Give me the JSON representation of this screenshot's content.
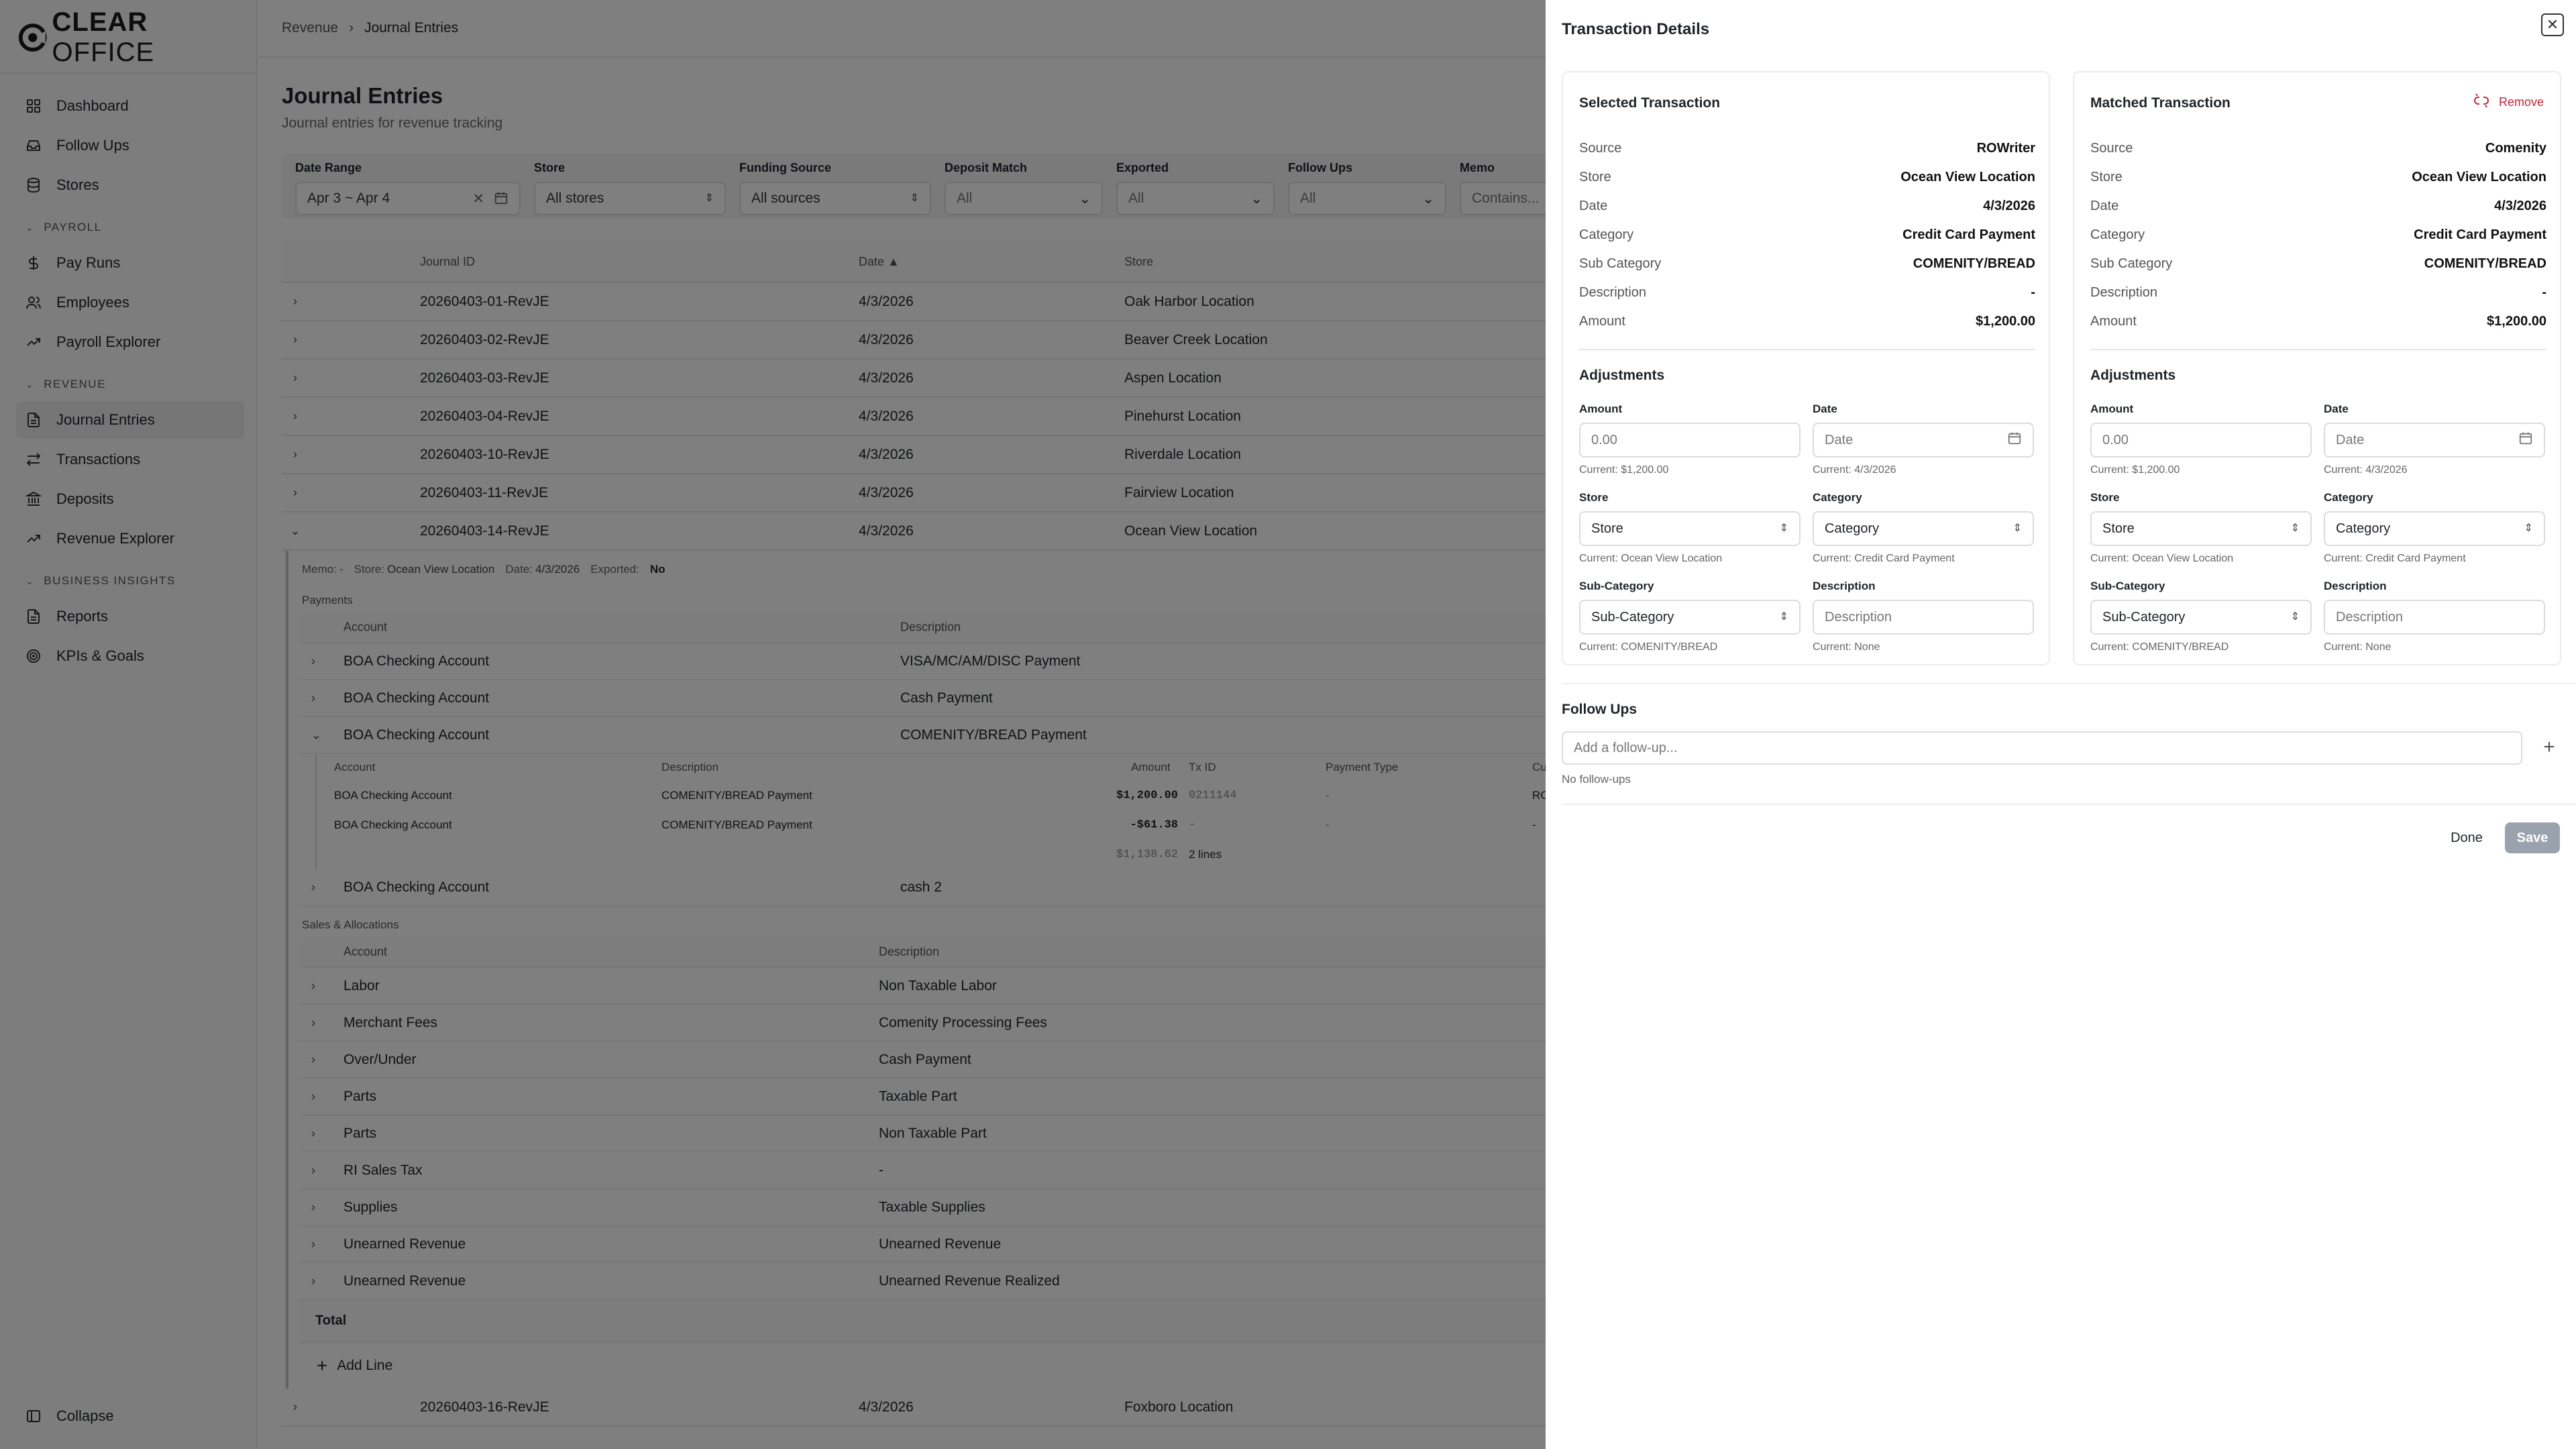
{
  "app": {
    "logo_text_bold": "CLEAR",
    "logo_text_light": " OFFICE"
  },
  "sidebar": {
    "items_top": [
      {
        "label": "Dashboard",
        "icon": "grid-icon"
      },
      {
        "label": "Follow Ups",
        "icon": "inbox-icon"
      },
      {
        "label": "Stores",
        "icon": "database-icon"
      }
    ],
    "groups": [
      {
        "label": "PAYROLL",
        "items": [
          {
            "label": "Pay Runs",
            "icon": "dollar-icon"
          },
          {
            "label": "Employees",
            "icon": "users-icon"
          },
          {
            "label": "Payroll Explorer",
            "icon": "trend-icon"
          }
        ]
      },
      {
        "label": "REVENUE",
        "items": [
          {
            "label": "Journal Entries",
            "icon": "file-icon",
            "active": true
          },
          {
            "label": "Transactions",
            "icon": "arrows-icon"
          },
          {
            "label": "Deposits",
            "icon": "bank-icon"
          },
          {
            "label": "Revenue Explorer",
            "icon": "trend-icon"
          }
        ]
      },
      {
        "label": "BUSINESS INSIGHTS",
        "items": [
          {
            "label": "Reports",
            "icon": "file-icon"
          },
          {
            "label": "KPIs & Goals",
            "icon": "target-icon"
          }
        ]
      }
    ],
    "collapse_label": "Collapse"
  },
  "breadcrumb": {
    "parent": "Revenue",
    "current": "Journal Entries"
  },
  "page": {
    "title": "Journal Entries",
    "subtitle": "Journal entries for revenue tracking"
  },
  "filters": {
    "date_range": {
      "label": "Date Range",
      "value": "Apr 3 ~ Apr 4"
    },
    "store": {
      "label": "Store",
      "value": "All stores"
    },
    "funding_source": {
      "label": "Funding Source",
      "value": "All sources"
    },
    "deposit_match": {
      "label": "Deposit Match",
      "value": "All"
    },
    "exported": {
      "label": "Exported",
      "value": "All"
    },
    "follow_ups": {
      "label": "Follow Ups",
      "value": "All"
    },
    "memo": {
      "label": "Memo",
      "placeholder": "Contains..."
    }
  },
  "table": {
    "headers": {
      "journal_id": "Journal ID",
      "date": "Date ▲",
      "store": "Store"
    },
    "rows_before": [
      {
        "id": "20260403-01-RevJE",
        "date": "4/3/2026",
        "store": "Oak Harbor Location"
      },
      {
        "id": "20260403-02-RevJE",
        "date": "4/3/2026",
        "store": "Beaver Creek Location"
      },
      {
        "id": "20260403-03-RevJE",
        "date": "4/3/2026",
        "store": "Aspen Location"
      },
      {
        "id": "20260403-04-RevJE",
        "date": "4/3/2026",
        "store": "Pinehurst Location"
      },
      {
        "id": "20260403-10-RevJE",
        "date": "4/3/2026",
        "store": "Riverdale Location"
      },
      {
        "id": "20260403-11-RevJE",
        "date": "4/3/2026",
        "store": "Fairview Location"
      }
    ],
    "expanded_row": {
      "id": "20260403-14-RevJE",
      "date": "4/3/2026",
      "store": "Ocean View Location"
    },
    "rows_after": [
      {
        "id": "20260403-16-RevJE",
        "date": "4/3/2026",
        "store": "Foxboro Location"
      }
    ]
  },
  "expanded": {
    "meta": {
      "memo_label": "Memo:",
      "memo_value": "-",
      "store_label": "Store:",
      "store_value": "Ocean View Location",
      "date_label": "Date:",
      "date_value": "4/3/2026",
      "exported_label": "Exported:",
      "exported_value": "No"
    },
    "payments_label": "Payments",
    "payments_headers": {
      "account": "Account",
      "description": "Description"
    },
    "payments": [
      {
        "account": "BOA Checking Account",
        "description": "VISA/MC/AM/DISC Payment"
      },
      {
        "account": "BOA Checking Account",
        "description": "Cash Payment"
      },
      {
        "account": "BOA Checking Account",
        "description": "COMENITY/BREAD Payment"
      }
    ],
    "nested_headers": {
      "account": "Account",
      "description": "Description",
      "amount": "Amount",
      "tx_id": "Tx ID",
      "payment_type": "Payment Type",
      "custom": "Custo"
    },
    "nested_rows": [
      {
        "account": "BOA Checking Account",
        "description": "COMENITY/BREAD Payment",
        "amount": "$1,200.00",
        "tx_id": "0211144",
        "payment_type": "-",
        "custom": "ROCK"
      },
      {
        "account": "BOA Checking Account",
        "description": "COMENITY/BREAD Payment",
        "amount": "-$61.38",
        "tx_id": "-",
        "payment_type": "-",
        "custom": "-"
      }
    ],
    "nested_total": {
      "amount": "$1,138.62",
      "lines": "2 lines"
    },
    "payments_after": [
      {
        "account": "BOA Checking Account",
        "description": "cash 2"
      }
    ],
    "sales_label": "Sales & Allocations",
    "sales_headers": {
      "account": "Account",
      "description": "Description"
    },
    "sales": [
      {
        "account": "Labor",
        "description": "Non Taxable Labor"
      },
      {
        "account": "Merchant Fees",
        "description": "Comenity Processing Fees"
      },
      {
        "account": "Over/Under",
        "description": "Cash Payment"
      },
      {
        "account": "Parts",
        "description": "Taxable Part"
      },
      {
        "account": "Parts",
        "description": "Non Taxable Part"
      },
      {
        "account": "RI Sales Tax",
        "description": "-"
      },
      {
        "account": "Supplies",
        "description": "Taxable Supplies"
      },
      {
        "account": "Unearned Revenue",
        "description": "Unearned Revenue"
      },
      {
        "account": "Unearned Revenue",
        "description": "Unearned Revenue Realized"
      }
    ],
    "total_label": "Total",
    "add_line_label": "Add Line"
  },
  "drawer": {
    "title": "Transaction Details",
    "cards": [
      {
        "title": "Selected Transaction",
        "remove_label": "",
        "fields": [
          {
            "k": "Source",
            "v": "ROWriter"
          },
          {
            "k": "Store",
            "v": "Ocean View Location"
          },
          {
            "k": "Date",
            "v": "4/3/2026"
          },
          {
            "k": "Category",
            "v": "Credit Card Payment"
          },
          {
            "k": "Sub Category",
            "v": "COMENITY/BREAD"
          },
          {
            "k": "Description",
            "v": "-"
          },
          {
            "k": "Amount",
            "v": "$1,200.00"
          }
        ],
        "adjustments": {
          "title": "Adjustments",
          "amount": {
            "label": "Amount",
            "placeholder": "0.00",
            "current": "Current: $1,200.00"
          },
          "date": {
            "label": "Date",
            "placeholder": "Date",
            "current": "Current: 4/3/2026"
          },
          "store": {
            "label": "Store",
            "placeholder": "Store",
            "current": "Current: Ocean View Location"
          },
          "category": {
            "label": "Category",
            "placeholder": "Category",
            "current": "Current: Credit Card Payment"
          },
          "subcategory": {
            "label": "Sub-Category",
            "placeholder": "Sub-Category",
            "current": "Current: COMENITY/BREAD"
          },
          "description": {
            "label": "Description",
            "placeholder": "Description",
            "current": "Current: None"
          }
        }
      },
      {
        "title": "Matched Transaction",
        "remove_label": "Remove",
        "fields": [
          {
            "k": "Source",
            "v": "Comenity"
          },
          {
            "k": "Store",
            "v": "Ocean View Location"
          },
          {
            "k": "Date",
            "v": "4/3/2026"
          },
          {
            "k": "Category",
            "v": "Credit Card Payment"
          },
          {
            "k": "Sub Category",
            "v": "COMENITY/BREAD"
          },
          {
            "k": "Description",
            "v": "-"
          },
          {
            "k": "Amount",
            "v": "$1,200.00"
          }
        ],
        "adjustments": {
          "title": "Adjustments",
          "amount": {
            "label": "Amount",
            "placeholder": "0.00",
            "current": "Current: $1,200.00"
          },
          "date": {
            "label": "Date",
            "placeholder": "Date",
            "current": "Current: 4/3/2026"
          },
          "store": {
            "label": "Store",
            "placeholder": "Store",
            "current": "Current: Ocean View Location"
          },
          "category": {
            "label": "Category",
            "placeholder": "Category",
            "current": "Current: Credit Card Payment"
          },
          "subcategory": {
            "label": "Sub-Category",
            "placeholder": "Sub-Category",
            "current": "Current: COMENITY/BREAD"
          },
          "description": {
            "label": "Description",
            "placeholder": "Description",
            "current": "Current: None"
          }
        }
      }
    ],
    "follow_ups": {
      "title": "Follow Ups",
      "placeholder": "Add a follow-up...",
      "empty": "No follow-ups"
    },
    "buttons": {
      "done": "Done",
      "save": "Save"
    }
  },
  "colors": {
    "overlay": "#000000",
    "danger": "#c0263a",
    "save_disabled": "#9aa3ad"
  }
}
